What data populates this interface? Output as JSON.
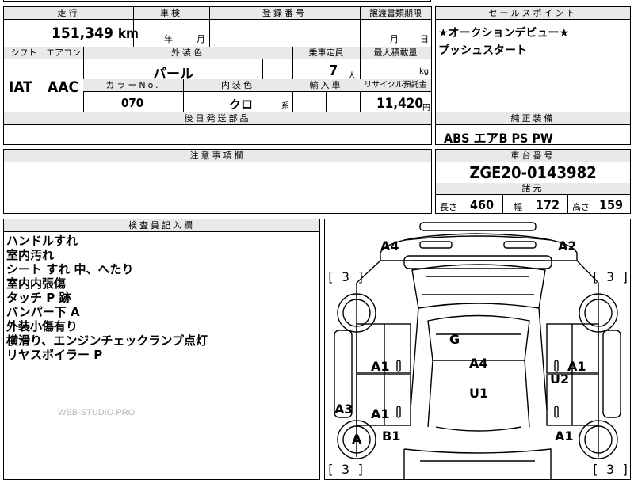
{
  "top_fragment": "",
  "spec": {
    "headers": {
      "mileage": "走行",
      "inspection": "車検",
      "registration": "登録番号",
      "transfer_deadline": "譲渡書類期限",
      "shift": "シフト",
      "aircon": "エアコン",
      "exterior_color": "外装色",
      "capacity": "乗車定員",
      "max_load": "最大積載量",
      "color_no": "カラーNo.",
      "interior_color": "内装色",
      "import": "輸入車",
      "recycle": "リサイクル預託金",
      "later_parts": "後日発送部品"
    },
    "mileage_value": "151,349",
    "mileage_unit": "km",
    "inspection_year": "年",
    "inspection_month": "月",
    "transfer_month": "月",
    "transfer_day": "日",
    "shift_value": "IAT",
    "aircon_value": "AAC",
    "exterior_value": "パール",
    "capacity_value": "7",
    "capacity_unit": "人",
    "load_unit": "kg",
    "color_no_value": "070",
    "interior_value": "クロ",
    "interior_suffix": "系",
    "recycle_value": "11,420",
    "recycle_unit": "円"
  },
  "sales_points": {
    "header": "セールスポイント",
    "lines": [
      "★オークションデビュー★",
      "プッシュスタート"
    ]
  },
  "equipment": {
    "header": "純正装備",
    "value": "ABS エアB PS PW"
  },
  "caution": {
    "header": "注意事項欄"
  },
  "chassis": {
    "header": "車台番号",
    "value": "ZGE20-0143982",
    "dims_header": "諸元",
    "length_label": "長さ",
    "length_value": "460",
    "width_label": "幅",
    "width_value": "172",
    "height_label": "高さ",
    "height_value": "159"
  },
  "inspector": {
    "header": "検査員記入欄",
    "notes": [
      "ハンドルすれ",
      "室内汚れ",
      "シート すれ 中、へたり",
      "室内内張傷",
      "タッチ P 跡",
      "バンパー下 A",
      "外装小傷有り",
      "横滑り、エンジンチェックランプ点灯",
      "リヤスポイラー P"
    ],
    "watermark": "WEB-STUDIO.PRO"
  },
  "diagram": {
    "marks": [
      "A4",
      "A2",
      "G",
      "A1",
      "A4",
      "A1",
      "U2",
      "U1",
      "A3",
      "A1",
      "A",
      "B1",
      "A1"
    ],
    "tire_marks": [
      "[ 3 ]",
      "[ 3 ]",
      "[ 3 ]",
      "[ 3 ]"
    ]
  }
}
